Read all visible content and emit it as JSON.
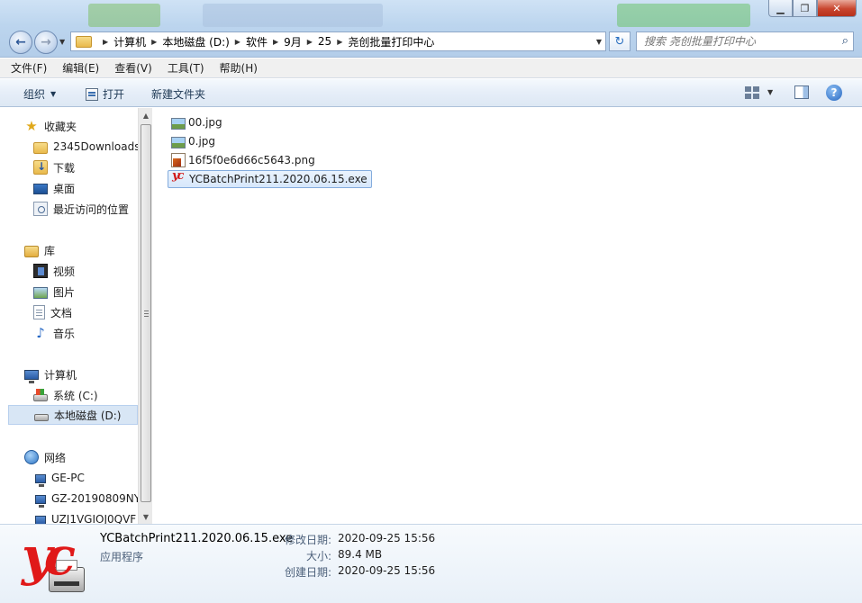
{
  "window": {
    "controls": {
      "minimize": "▁",
      "restore": "❐",
      "close": "✕"
    }
  },
  "nav": {
    "back_icon": "back-arrow-icon",
    "forward_icon": "forward-arrow-icon",
    "address_segments": [
      "计算机",
      "本地磁盘 (D:)",
      "软件",
      "9月",
      "25",
      "尧创批量打印中心"
    ],
    "search_placeholder": "搜索 尧创批量打印中心"
  },
  "menubar": [
    "文件(F)",
    "编辑(E)",
    "查看(V)",
    "工具(T)",
    "帮助(H)"
  ],
  "toolbar": {
    "organize": "组织",
    "open": "打开",
    "new_folder": "新建文件夹"
  },
  "sidebar": {
    "favorites": {
      "label": "收藏夹",
      "items": [
        "2345Downloads",
        "下载",
        "桌面",
        "最近访问的位置"
      ]
    },
    "libraries": {
      "label": "库",
      "items": [
        "视频",
        "图片",
        "文档",
        "音乐"
      ]
    },
    "computer": {
      "label": "计算机",
      "items": [
        "系统 (C:)",
        "本地磁盘 (D:)"
      ],
      "selected": "本地磁盘 (D:)"
    },
    "network": {
      "label": "网络",
      "items": [
        "GE-PC",
        "GZ-20190809NY",
        "UZJ1VGIOJ0QVF"
      ]
    }
  },
  "files": [
    {
      "name": "00.jpg",
      "type": "jpg"
    },
    {
      "name": "0.jpg",
      "type": "jpg"
    },
    {
      "name": "16f5f0e6d66c5643.png",
      "type": "png"
    },
    {
      "name": "YCBatchPrint211.2020.06.15.exe",
      "type": "exe",
      "selected": true
    }
  ],
  "details": {
    "name": "YCBatchPrint211.2020.06.15.exe",
    "type": "应用程序",
    "modified_label": "修改日期:",
    "modified": "2020-09-25 15:56",
    "size_label": "大小:",
    "size": "89.4 MB",
    "created_label": "创建日期:",
    "created": "2020-09-25 15:56"
  }
}
